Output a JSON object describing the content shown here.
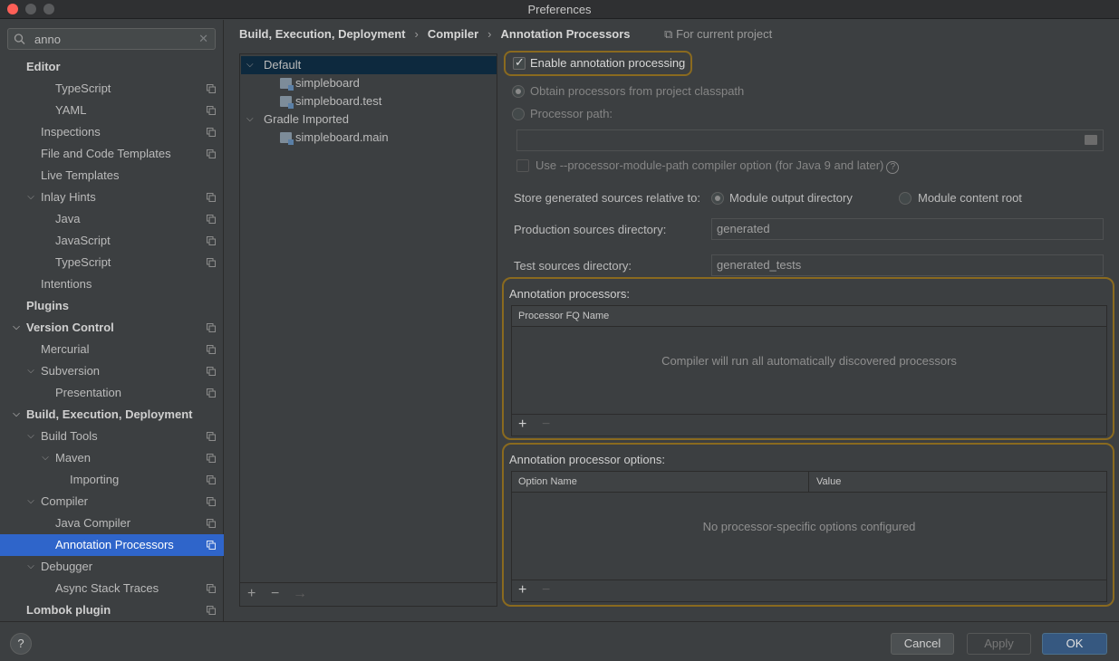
{
  "window": {
    "title": "Preferences"
  },
  "search": {
    "value": "anno",
    "clear_icon": "close-icon"
  },
  "sidebar": {
    "items": [
      {
        "label": "Editor",
        "level": 0,
        "bold": true,
        "arrow": "",
        "copy": false
      },
      {
        "label": "TypeScript",
        "level": 2,
        "bold": false,
        "arrow": "",
        "copy": true
      },
      {
        "label": "YAML",
        "level": 2,
        "bold": false,
        "arrow": "",
        "copy": true
      },
      {
        "label": "Inspections",
        "level": 1,
        "bold": false,
        "arrow": "",
        "copy": true
      },
      {
        "label": "File and Code Templates",
        "level": 1,
        "bold": false,
        "arrow": "",
        "copy": true
      },
      {
        "label": "Live Templates",
        "level": 1,
        "bold": false,
        "arrow": "",
        "copy": false
      },
      {
        "label": "Inlay Hints",
        "level": 1,
        "bold": false,
        "arrow": "down",
        "copy": true
      },
      {
        "label": "Java",
        "level": 2,
        "bold": false,
        "arrow": "",
        "copy": true
      },
      {
        "label": "JavaScript",
        "level": 2,
        "bold": false,
        "arrow": "",
        "copy": true
      },
      {
        "label": "TypeScript",
        "level": 2,
        "bold": false,
        "arrow": "",
        "copy": true
      },
      {
        "label": "Intentions",
        "level": 1,
        "bold": false,
        "arrow": "",
        "copy": false
      },
      {
        "label": "Plugins",
        "level": 0,
        "bold": true,
        "arrow": "",
        "copy": false
      },
      {
        "label": "Version Control",
        "level": 0,
        "bold": true,
        "arrow": "down",
        "copy": true
      },
      {
        "label": "Mercurial",
        "level": 1,
        "bold": false,
        "arrow": "",
        "copy": true
      },
      {
        "label": "Subversion",
        "level": 1,
        "bold": false,
        "arrow": "down",
        "copy": true
      },
      {
        "label": "Presentation",
        "level": 2,
        "bold": false,
        "arrow": "",
        "copy": true
      },
      {
        "label": "Build, Execution, Deployment",
        "level": 0,
        "bold": true,
        "arrow": "down",
        "copy": false
      },
      {
        "label": "Build Tools",
        "level": 1,
        "bold": false,
        "arrow": "down",
        "copy": true
      },
      {
        "label": "Maven",
        "level": 2,
        "bold": false,
        "arrow": "down",
        "copy": true
      },
      {
        "label": "Importing",
        "level": 3,
        "bold": false,
        "arrow": "",
        "copy": true
      },
      {
        "label": "Compiler",
        "level": 1,
        "bold": false,
        "arrow": "down",
        "copy": true
      },
      {
        "label": "Java Compiler",
        "level": 2,
        "bold": false,
        "arrow": "",
        "copy": true
      },
      {
        "label": "Annotation Processors",
        "level": 2,
        "bold": false,
        "arrow": "",
        "copy": true,
        "selected": true
      },
      {
        "label": "Debugger",
        "level": 1,
        "bold": false,
        "arrow": "down",
        "copy": false
      },
      {
        "label": "Async Stack Traces",
        "level": 2,
        "bold": false,
        "arrow": "",
        "copy": true
      },
      {
        "label": "Lombok plugin",
        "level": 0,
        "bold": true,
        "arrow": "",
        "copy": true
      }
    ]
  },
  "breadcrumb": {
    "items": [
      "Build, Execution, Deployment",
      "Compiler",
      "Annotation Processors"
    ],
    "scope": "For current project"
  },
  "profiles": {
    "items": [
      {
        "label": "Default",
        "type": "group"
      },
      {
        "label": "simpleboard",
        "type": "module"
      },
      {
        "label": "simpleboard.test",
        "type": "module"
      },
      {
        "label": "Gradle Imported",
        "type": "group"
      },
      {
        "label": "simpleboard.main",
        "type": "module"
      }
    ],
    "add": "+",
    "remove": "−",
    "move": "→"
  },
  "settings": {
    "enable_label": "Enable annotation processing",
    "enable_checked": true,
    "obtain_label": "Obtain processors from project classpath",
    "processor_path_label": "Processor path:",
    "processor_path_value": "",
    "module_path_label": "Use --processor-module-path compiler option (for Java 9 and later)",
    "store_label": "Store generated sources relative to:",
    "store_option_1": "Module output directory",
    "store_option_2": "Module content root",
    "prod_label": "Production sources directory:",
    "prod_value": "generated",
    "test_label": "Test sources directory:",
    "test_value": "generated_tests"
  },
  "processors": {
    "title": "Annotation processors:",
    "column": "Processor FQ Name",
    "empty": "Compiler will run all automatically discovered processors",
    "add": "+",
    "remove": "−"
  },
  "options": {
    "title": "Annotation processor options:",
    "col_name": "Option Name",
    "col_value": "Value",
    "empty": "No processor-specific options configured",
    "add": "+",
    "remove": "−"
  },
  "buttons": {
    "help": "?",
    "cancel": "Cancel",
    "apply": "Apply",
    "ok": "OK"
  },
  "colors": {
    "accent": "#2f65ca",
    "highlight": "#8a6a1f",
    "ok": "#365880"
  }
}
